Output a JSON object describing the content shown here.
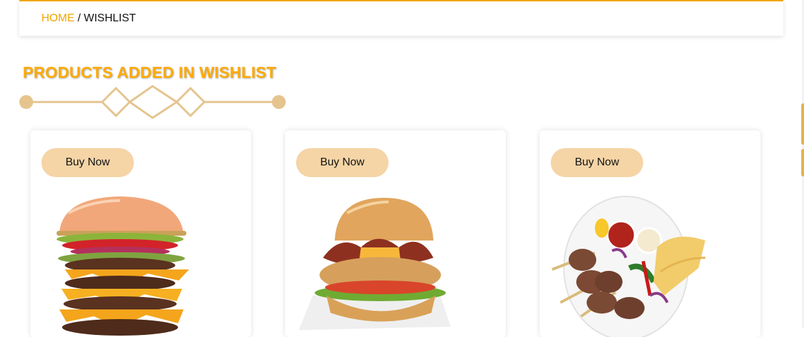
{
  "breadcrumb": {
    "home": "HOME",
    "separator": " / ",
    "current": "WISHLIST"
  },
  "section": {
    "title": "PRODUCTS ADDED IN WISHLIST"
  },
  "colors": {
    "accent": "#f0a500",
    "button_bg": "#f5d4a6",
    "divider": "#e5c48e"
  },
  "products": [
    {
      "button_label": "Buy Now",
      "image": "stacked-cheeseburger"
    },
    {
      "button_label": "Buy Now",
      "image": "bacon-chicken-burger"
    },
    {
      "button_label": "Buy Now",
      "image": "kebab-plate"
    }
  ]
}
